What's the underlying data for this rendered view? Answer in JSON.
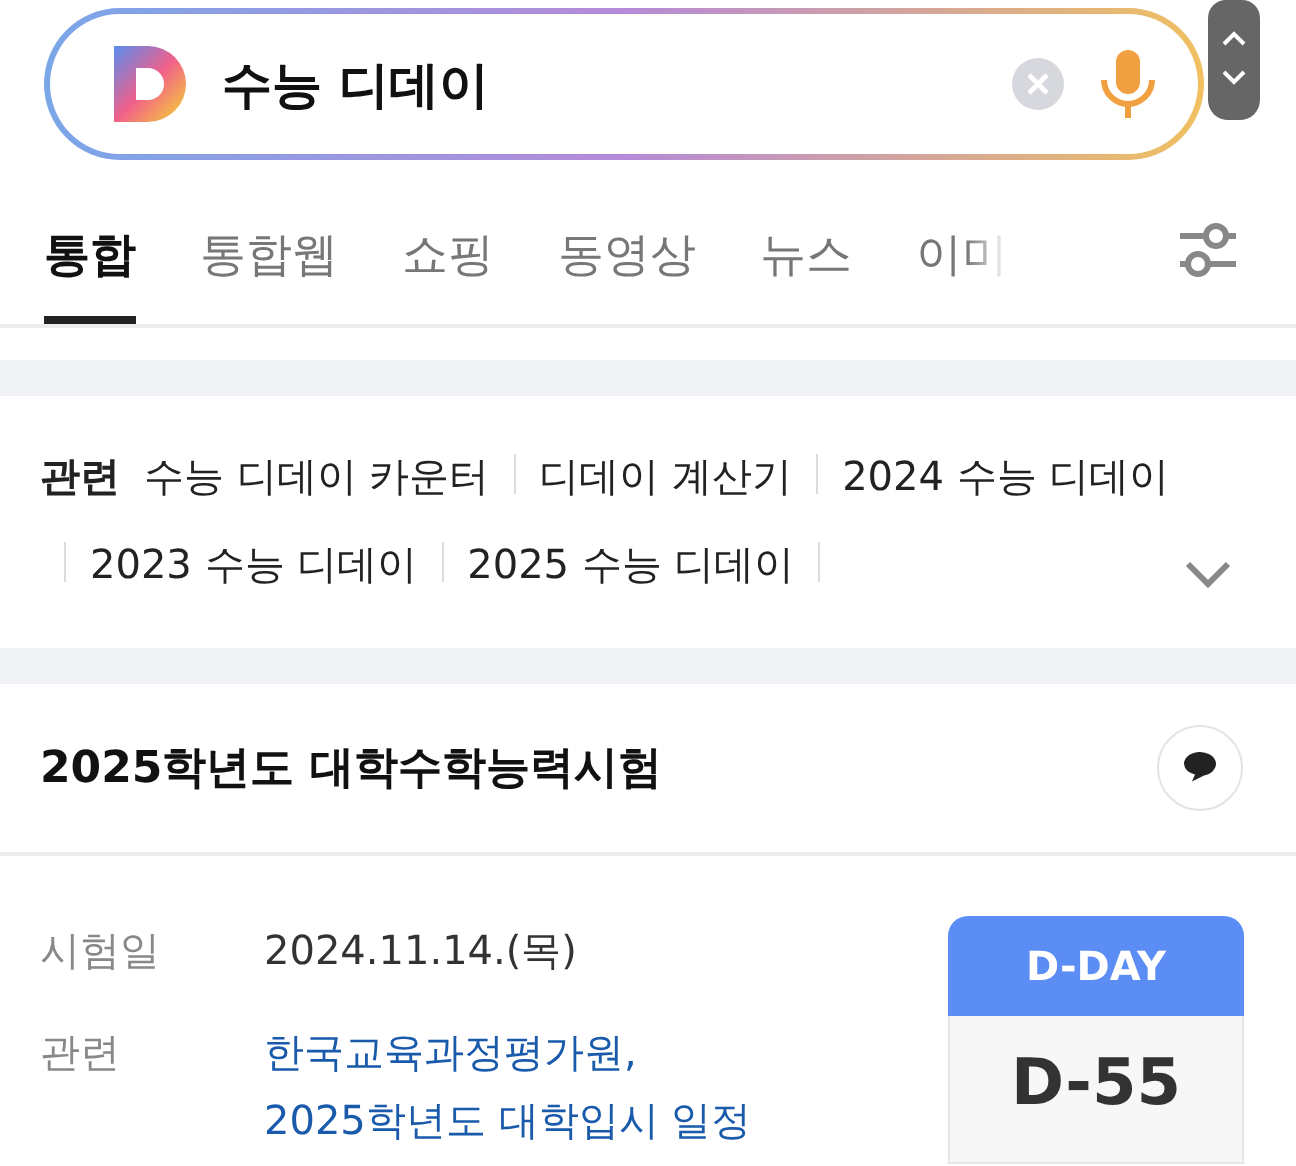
{
  "search": {
    "value": "수능 디데이"
  },
  "tabs": [
    {
      "label": "통합",
      "selected": true
    },
    {
      "label": "통합웹",
      "selected": false
    },
    {
      "label": "쇼핑",
      "selected": false
    },
    {
      "label": "동영상",
      "selected": false
    },
    {
      "label": "뉴스",
      "selected": false
    },
    {
      "label": "이미",
      "selected": false
    }
  ],
  "related": {
    "label": "관련",
    "items": [
      "수능 디데이 카운터",
      "디데이 계산기",
      "2024 수능 디데이",
      "2023 수능 디데이",
      "2025 수능 디데이"
    ]
  },
  "card": {
    "title": "2025학년도 대학수학능력시험",
    "rows": [
      {
        "kind": "text",
        "label": "시험일",
        "value": "2024.11.14.(목)"
      },
      {
        "kind": "links",
        "label": "관련",
        "links": [
          "한국교육과정평가원,",
          "2025학년도 대학입시 일정"
        ]
      }
    ],
    "dday": {
      "label": "D-DAY",
      "value": "D-55"
    }
  }
}
